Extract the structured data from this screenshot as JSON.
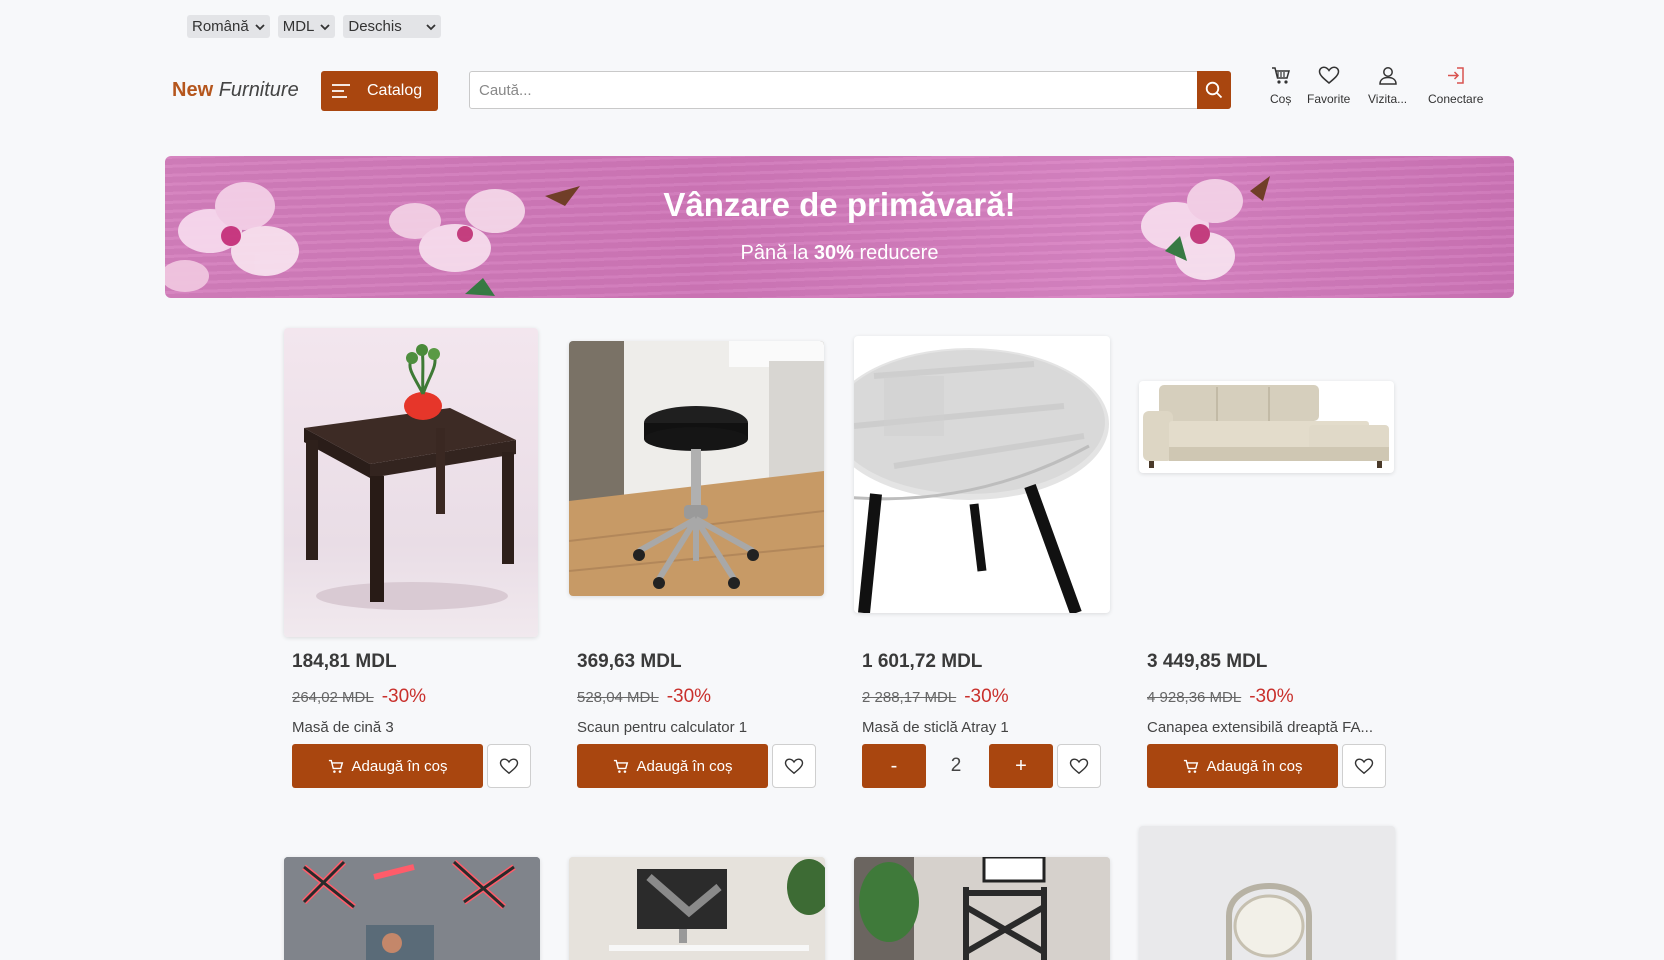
{
  "top_selects": [
    {
      "label": "Română"
    },
    {
      "label": "MDL"
    },
    {
      "label": "Deschis"
    }
  ],
  "header": {
    "logo_bold": "New",
    "logo_italic": "Furniture",
    "catalog_label": "Catalog",
    "search_placeholder": "Caută...",
    "icons": [
      {
        "label": "Coș",
        "icon": "cart-icon"
      },
      {
        "label": "Favorite",
        "icon": "heart-icon"
      },
      {
        "label": "Vizita...",
        "icon": "user-icon"
      },
      {
        "label": "Conectare",
        "icon": "login-icon"
      }
    ]
  },
  "banner": {
    "title": "Vânzare de primăvară!",
    "subtitle_pre": "Până la ",
    "subtitle_bold": "30%",
    "subtitle_post": " reducere"
  },
  "products": [
    {
      "price": "184,81 MDL",
      "old_price": "264,02 MDL",
      "discount": "-30%",
      "name": "Masă de cină 3",
      "add_label": "Adaugă în coș"
    },
    {
      "price": "369,63 MDL",
      "old_price": "528,04 MDL",
      "discount": "-30%",
      "name": "Scaun pentru calculator 1",
      "add_label": "Adaugă în coș"
    },
    {
      "price": "1 601,72 MDL",
      "old_price": "2 288,17 MDL",
      "discount": "-30%",
      "name": "Masă de sticlă Atray 1",
      "qty_minus": "-",
      "qty_value": "2",
      "qty_plus": "+"
    },
    {
      "price": "3 449,85 MDL",
      "old_price": "4 928,36 MDL",
      "discount": "-30%",
      "name": "Canapea extensibilă dreaptă FA...",
      "add_label": "Adaugă în coș"
    }
  ],
  "colors": {
    "accent": "#a9460f",
    "discount": "#c9302c",
    "banner": "#d47fbd"
  }
}
